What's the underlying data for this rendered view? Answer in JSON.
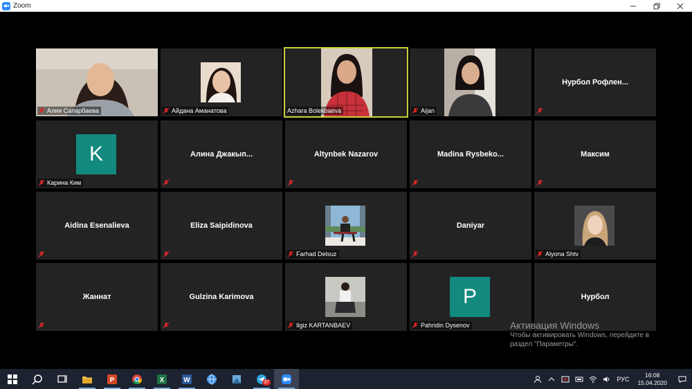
{
  "window": {
    "title": "Zoom"
  },
  "tiles": [
    {
      "name": "Алия Сапарбаева",
      "label": "",
      "muted": true,
      "video": true
    },
    {
      "name": "Айдана Аманатова",
      "label": "",
      "muted": true,
      "video": true
    },
    {
      "name": "Azhara Bolekbaeva",
      "label": "",
      "muted": false,
      "video": true,
      "active": true
    },
    {
      "name": "Aijan",
      "label": "",
      "muted": true,
      "video": true
    },
    {
      "name": "",
      "label": "Нурбол Рофлен...",
      "muted": true,
      "video": false
    },
    {
      "name": "Карина Ким",
      "label": "",
      "muted": true,
      "video": false,
      "avatar_letter": "K",
      "avatar_color": "#128a7e"
    },
    {
      "name": "",
      "label": "Алина Джакып...",
      "muted": true,
      "video": false
    },
    {
      "name": "",
      "label": "Altynbek Nazarov",
      "muted": true,
      "video": false
    },
    {
      "name": "",
      "label": "Madina Rysbeko...",
      "muted": true,
      "video": false
    },
    {
      "name": "",
      "label": "Максим",
      "muted": true,
      "video": false
    },
    {
      "name": "",
      "label": "Aidina Esenalieva",
      "muted": true,
      "video": false
    },
    {
      "name": "",
      "label": "Eliza Saipidinova",
      "muted": true,
      "video": false
    },
    {
      "name": "Farhad Delsuz",
      "label": "",
      "muted": true,
      "video": true
    },
    {
      "name": "",
      "label": "Daniyar",
      "muted": true,
      "video": false
    },
    {
      "name": "Alyona Shtv",
      "label": "",
      "muted": true,
      "video": true
    },
    {
      "name": "",
      "label": "Жаннат",
      "muted": true,
      "video": false
    },
    {
      "name": "",
      "label": "Gulzina Karimova",
      "muted": true,
      "video": false
    },
    {
      "name": "Ilgiz KARTANBAEV",
      "label": "",
      "muted": true,
      "video": true
    },
    {
      "name": "Pahridin Dysenov",
      "label": "",
      "muted": true,
      "video": false,
      "avatar_letter": "P",
      "avatar_color": "#128a7e"
    },
    {
      "name": "",
      "label": "Нурбол",
      "muted": true,
      "video": false
    }
  ],
  "watermark": {
    "title": "Активация Windows",
    "line1": "Чтобы активировать Windows, перейдите в",
    "line2": "раздел \"Параметры\"."
  },
  "taskbar": {
    "apps": [
      "start-icon",
      "search-icon",
      "task-view-icon",
      "file-explorer-icon",
      "powerpoint-icon",
      "chrome-icon",
      "excel-icon",
      "word-icon",
      "globe-app-icon",
      "media-app-icon",
      "telegram-icon",
      "zoom-icon"
    ],
    "telegram_badge": "37",
    "language": "РУС",
    "time": "16:08",
    "date": "15.04.2020"
  },
  "colors": {
    "tile_bg": "#232323",
    "active_border": "#c8d23a",
    "muted_red": "#e02828",
    "avatar_teal": "#128a7e",
    "taskbar_bg": "#1c2230"
  }
}
